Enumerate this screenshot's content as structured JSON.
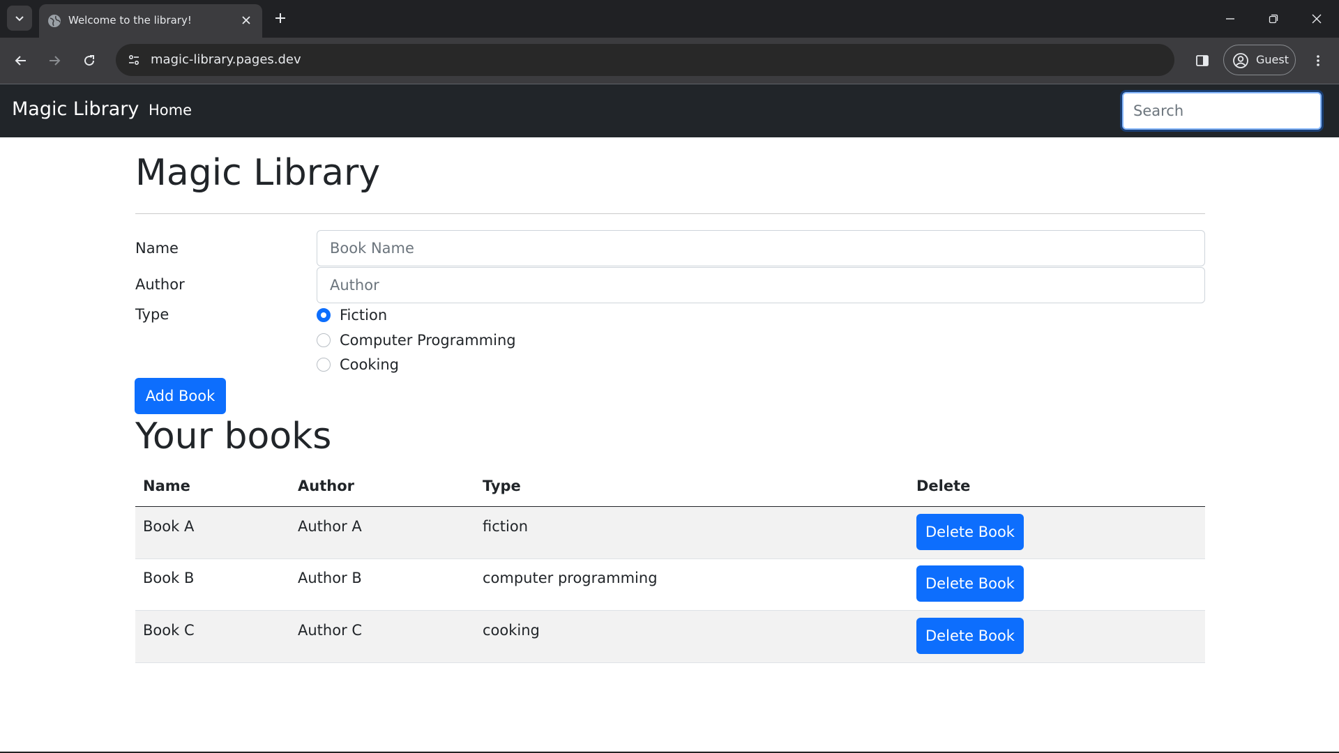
{
  "browser": {
    "tab": {
      "title": "Welcome to the library!"
    },
    "address_bar": {
      "url": "magic-library.pages.dev"
    },
    "profile": {
      "label": "Guest"
    },
    "icons": [
      "tab-search-icon",
      "globe-icon",
      "close-icon",
      "plus-icon",
      "minimize-icon",
      "restore-icon",
      "window-close-icon",
      "back-arrow-icon",
      "forward-arrow-icon",
      "reload-icon",
      "site-info-icon",
      "side-panel-icon",
      "profile-icon",
      "kebab-menu-icon"
    ]
  },
  "navbar": {
    "brand": "Magic Library",
    "links": [
      {
        "label": "Home"
      }
    ],
    "search": {
      "placeholder": "Search",
      "value": ""
    }
  },
  "page": {
    "title": "Magic Library",
    "form": {
      "name": {
        "label": "Name",
        "placeholder": "Book Name",
        "value": ""
      },
      "author": {
        "label": "Author",
        "placeholder": "Author",
        "value": ""
      },
      "type": {
        "label": "Type",
        "options": [
          {
            "label": "Fiction",
            "checked": true
          },
          {
            "label": "Computer Programming",
            "checked": false
          },
          {
            "label": "Cooking",
            "checked": false
          }
        ]
      },
      "submit_label": "Add Book"
    },
    "books_section": {
      "title": "Your books",
      "columns": [
        "Name",
        "Author",
        "Type",
        "Delete"
      ],
      "rows": [
        {
          "name": "Book A",
          "author": "Author A",
          "type": "fiction",
          "action": "Delete Book"
        },
        {
          "name": "Book B",
          "author": "Author B",
          "type": "computer programming",
          "action": "Delete Book"
        },
        {
          "name": "Book C",
          "author": "Author C",
          "type": "cooking",
          "action": "Delete Book"
        }
      ]
    }
  },
  "colors": {
    "primary": "#0d6efd",
    "navbar": "#212529",
    "chrome_dark": "#202124",
    "chrome_toolbar": "#3c3c3f",
    "stripe": "#f2f2f2"
  }
}
